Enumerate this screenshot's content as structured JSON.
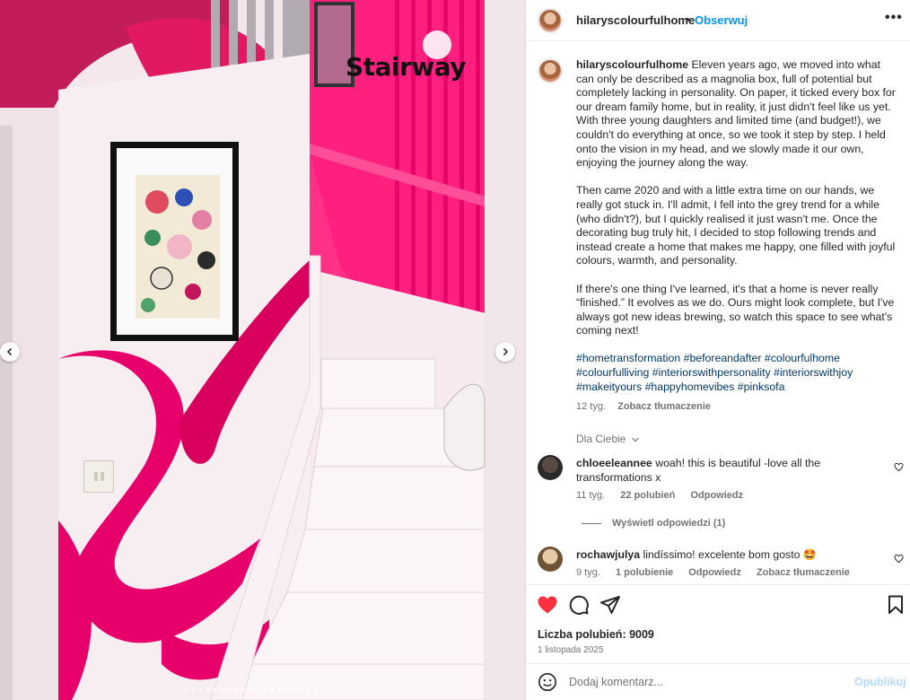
{
  "media": {
    "overlay_title": "Stairway",
    "prev_icon": "chevron-left",
    "next_icon": "chevron-right",
    "carousel_count": 20,
    "carousel_active": 12
  },
  "header": {
    "username": "hilaryscolourfulhome",
    "separator": "•",
    "follow_label": "Obserwuj",
    "more_label": "•••"
  },
  "caption": {
    "username": "hilaryscolourfulhome",
    "paragraphs": [
      "Eleven years ago, we moved into what can only be described as a magnolia box, full of potential but completely lacking in personality. On paper, it ticked every box for our dream family home, but in reality, it just didn't feel like us yet. With three young daughters and limited time (and budget!), we couldn't do everything at once, so we took it step by step. I held onto the vision in my head, and we slowly made it our own, enjoying the journey along the way.",
      "Then came 2020 and with a little extra time on our hands, we really got stuck in. I'll admit, I fell into the grey trend for a while (who didn't?), but I quickly realised it just wasn't me. Once the decorating bug truly hit, I decided to stop following trends and instead create a home that makes me happy, one filled with joyful colours, warmth, and personality.",
      "If there's one thing I've learned, it's that a home is never really “finished.” It evolves as we do. Ours might look complete, but I've always got new ideas brewing, so watch this space to see what's coming next!"
    ],
    "hashtags": [
      "#hometransformation",
      "#beforeandafter",
      "#colourfulhome",
      "#colourfulliving",
      "#interiorswithpersonality",
      "#interiorswithjoy",
      "#makeityours",
      "#happyhomevibes",
      "#pinksofa"
    ],
    "time": "12 tyg.",
    "translate": "Zobacz tłumaczenie"
  },
  "for_you": "Dla Ciebie",
  "comments": [
    {
      "username": "chloeeleannee",
      "text": "woah! this is beautiful -love all the transformations x",
      "time": "11 tyg.",
      "likes": "22 polubień",
      "reply": "Odpowiedz",
      "view_replies": "Wyświetl odpowiedzi (1)"
    },
    {
      "username": "rochawjulya",
      "text": "lindíssimo! excelente bom gosto 🤩",
      "time": "9 tyg.",
      "likes": "1 polubienie",
      "reply": "Odpowiedz",
      "translate": "Zobacz tłumaczenie"
    }
  ],
  "actions": {
    "like_icon": "heart-filled",
    "comment_icon": "comment",
    "share_icon": "paper-plane",
    "save_icon": "bookmark",
    "likes_text": "Liczba polubień: 9009",
    "date": "1 listopada 2025"
  },
  "add_comment": {
    "placeholder": "Dodaj komentarz...",
    "publish_label": "Opublikuj"
  },
  "colors": {
    "accent_pink": "#ff1a75",
    "follow_blue": "#0095f6",
    "hashtag_blue": "#00376b",
    "like_red": "#ff3040"
  }
}
